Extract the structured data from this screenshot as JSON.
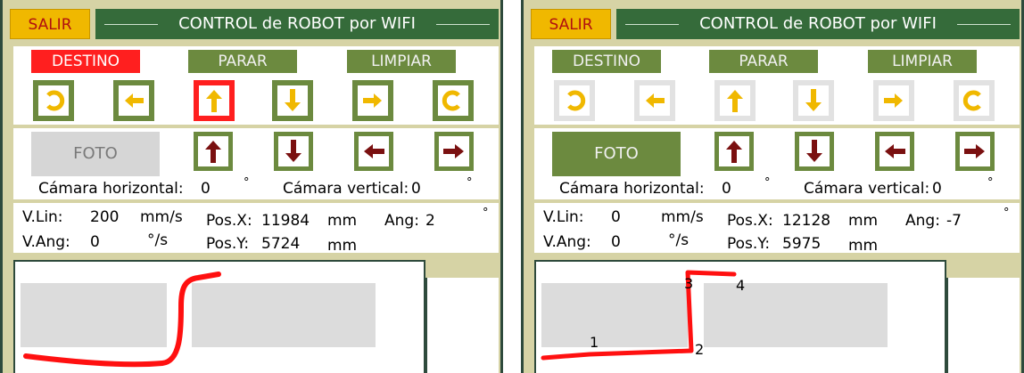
{
  "panels": [
    {
      "salir": "SALIR",
      "title": "CONTROL de ROBOT por WIFI",
      "buttons": {
        "destino": "DESTINO",
        "parar": "PARAR",
        "limpiar": "LIMPIAR"
      },
      "foto": "FOTO",
      "camera": {
        "horizontal_label": "Cámara horizontal:",
        "horizontal_value": "0",
        "vertical_label": "Cámara vertical:",
        "vertical_value": "0",
        "degree": "°"
      },
      "telemetry": {
        "vlin_label": "V.Lin:",
        "vlin_value": "200",
        "vlin_unit": "mm/s",
        "posx_label": "Pos.X:",
        "posx_value": "11984",
        "posx_unit": "mm",
        "ang_label": "Ang:",
        "ang_value": "2",
        "ang_unit": "°",
        "vang_label": "V.Ang:",
        "vang_value": "0",
        "vang_unit": "°/s",
        "posy_label": "Pos.Y:",
        "posy_value": "5724",
        "posy_unit": "mm"
      },
      "path_labels": []
    },
    {
      "salir": "SALIR",
      "title": "CONTROL de ROBOT por WIFI",
      "buttons": {
        "destino": "DESTINO",
        "parar": "PARAR",
        "limpiar": "LIMPIAR"
      },
      "foto": "FOTO",
      "camera": {
        "horizontal_label": "Cámara horizontal:",
        "horizontal_value": "0",
        "vertical_label": "Cámara vertical:",
        "vertical_value": "0",
        "degree": "°"
      },
      "telemetry": {
        "vlin_label": "V.Lin:",
        "vlin_value": "0",
        "vlin_unit": "mm/s",
        "posx_label": "Pos.X:",
        "posx_value": "12128",
        "posx_unit": "mm",
        "ang_label": "Ang:",
        "ang_value": "-7",
        "ang_unit": "°",
        "vang_label": "V.Ang:",
        "vang_value": "0",
        "vang_unit": "°/s",
        "posy_label": "Pos.Y:",
        "posy_value": "5975",
        "posy_unit": "mm"
      },
      "path_labels": [
        "1",
        "2",
        "3",
        "4"
      ]
    }
  ]
}
